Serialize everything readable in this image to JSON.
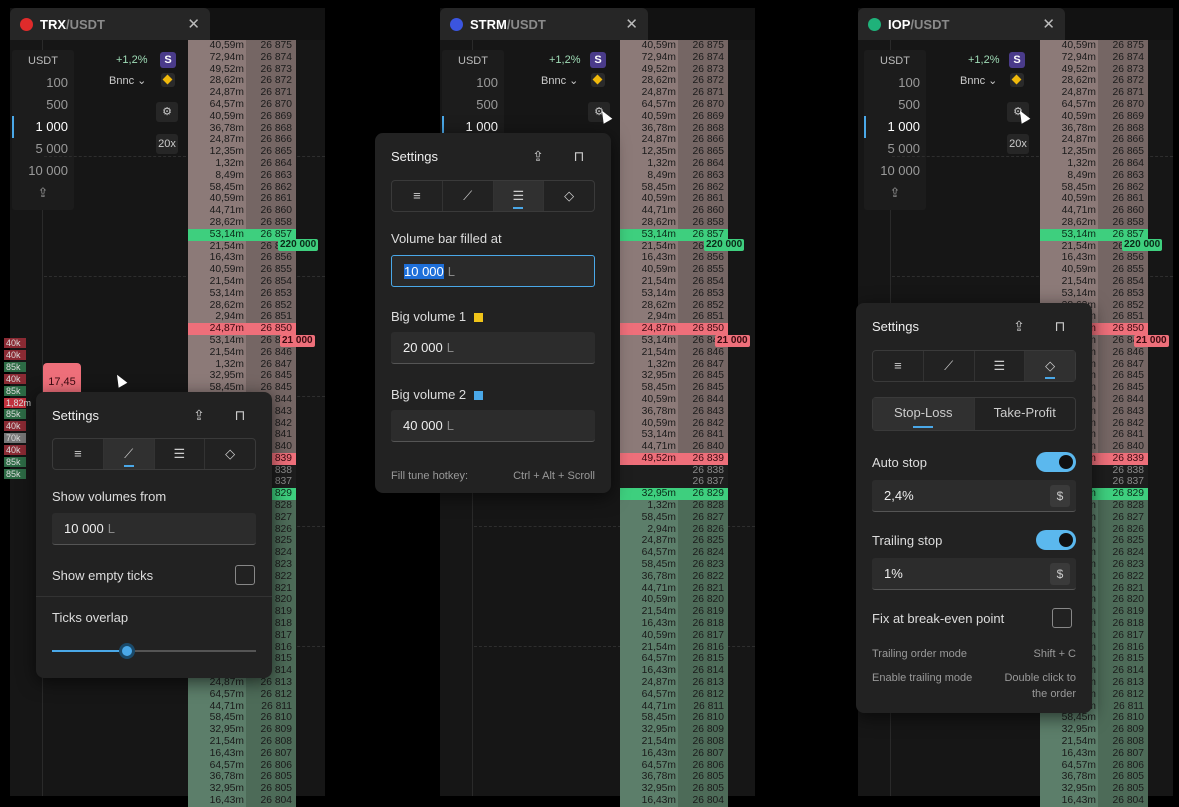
{
  "colors": {
    "accent": "#4aa8e8",
    "ask": "#8c7a78",
    "bid": "#5c7e6a",
    "green": "#3ecf7e",
    "red": "#ee6f7a",
    "yellow": "#f0c419",
    "blue": "#4aa8e8"
  },
  "panels": [
    {
      "tab": {
        "base": "TRX",
        "quote": "/USDT",
        "close": "✕",
        "icon_color": "#e02b2b"
      },
      "steps": {
        "head": "USDT",
        "values": [
          "100",
          "500",
          "1 000",
          "5 000",
          "10 000"
        ],
        "selected": "1 000"
      },
      "change": "+1,2%",
      "exchange": "Bnnc ⌄",
      "badge": "S",
      "leverage": "20x",
      "bigvol_green": "220 000",
      "bigvol_red": "21 000",
      "left_chip": "17,45"
    },
    {
      "tab": {
        "base": "STRM",
        "quote": "/USDT",
        "close": "✕",
        "icon_color": "#3b55e0"
      },
      "steps": {
        "head": "USDT",
        "values": [
          "100",
          "500",
          "1 000"
        ],
        "selected": "1 000"
      },
      "change": "+1,2%",
      "exchange": "Bnnc ⌄",
      "badge": "S",
      "bigvol_green": "220 000",
      "bigvol_red": "21 000"
    },
    {
      "tab": {
        "base": "IOP",
        "quote": "/USDT",
        "close": "✕",
        "icon_color": "#1fb27a"
      },
      "steps": {
        "head": "USDT",
        "values": [
          "100",
          "500",
          "1 000",
          "5 000",
          "10 000"
        ],
        "selected": "1 000"
      },
      "change": "+1,2%",
      "exchange": "Bnnc ⌄",
      "badge": "S",
      "leverage": "20x",
      "bigvol_green": "220 000",
      "bigvol_red": "21 000"
    }
  ],
  "orderbook": {
    "vols": [
      "40,59m",
      "72,94m",
      "49,52m",
      "28,62m",
      "24,87m",
      "64,57m",
      "40,59m",
      "36,78m",
      "24,87m",
      "12,35m",
      "1,32m",
      "8,49m",
      "58,45m",
      "40,59m",
      "44,71m",
      "28,62m",
      "53,14m",
      "21,54m",
      "16,43m",
      "40,59m",
      "21,54m",
      "53,14m",
      "28,62m",
      "2,94m",
      "24,87m",
      "53,14m",
      "21,54m",
      "1,32m",
      "32,95m",
      "58,45m",
      "40,59m",
      "36,78m",
      "40,59m",
      "53,14m",
      "44,71m",
      "49,52m",
      "",
      "",
      "32,95m",
      "1,32m",
      "58,45m",
      "2,94m",
      "24,87m",
      "64,57m",
      "58,45m",
      "36,78m",
      "44,71m",
      "40,59m",
      "21,54m",
      "16,43m",
      "40,59m",
      "21,54m",
      "64,57m",
      "16,43m",
      "24,87m",
      "64,57m",
      "44,71m",
      "58,45m",
      "32,95m",
      "21,54m",
      "16,43m",
      "64,57m",
      "36,78m",
      "32,95m",
      "16,43m"
    ],
    "prices": [
      "26 875",
      "26 874",
      "26 873",
      "26 872",
      "26 871",
      "26 870",
      "26 869",
      "26 868",
      "26 866",
      "26 865",
      "26 864",
      "26 863",
      "26 862",
      "26 861",
      "26 860",
      "26 858",
      "26 857",
      "26 857",
      "26 856",
      "26 855",
      "26 854",
      "26 853",
      "26 852",
      "26 851",
      "26 850",
      "26 848",
      "26 846",
      "26 847",
      "26 845",
      "26 845",
      "26 844",
      "26 843",
      "26 842",
      "26 841",
      "26 840",
      "26 839",
      "26 838",
      "26 837",
      "26 829",
      "26 828",
      "26 827",
      "26 826",
      "26 825",
      "26 824",
      "26 823",
      "26 822",
      "26 821",
      "26 820",
      "26 819",
      "26 818",
      "26 817",
      "26 816",
      "26 815",
      "26 814",
      "26 813",
      "26 812",
      "26 811",
      "26 810",
      "26 809",
      "26 808",
      "26 807",
      "26 806",
      "26 805",
      "26 805",
      "26 804"
    ]
  },
  "left_vols": [
    "40k",
    "40k",
    "85k",
    "40k",
    "85k",
    "1,82m",
    "85k",
    "40k",
    "70k",
    "40k",
    "85k",
    "85k"
  ],
  "settings_a": {
    "title": "Settings",
    "section_label": "Show volumes from",
    "field_value": "10 000",
    "field_unit": "L",
    "empty_ticks_label": "Show empty ticks",
    "overlap_label": "Ticks overlap",
    "slider_value": 0.37
  },
  "settings_b": {
    "title": "Settings",
    "filled_label": "Volume bar filled at",
    "filled_value": "10 000",
    "filled_unit": "L",
    "big1_label": "Big volume 1",
    "big1_value": "20 000",
    "big1_unit": "L",
    "big2_label": "Big volume 2",
    "big2_value": "40 000",
    "big2_unit": "L",
    "hotkey_label": "Fill tune hotkey:",
    "hotkey_value": "Ctrl + Alt + Scroll"
  },
  "settings_c": {
    "title": "Settings",
    "tab_sl": "Stop-Loss",
    "tab_tp": "Take-Profit",
    "auto_stop_label": "Auto stop",
    "auto_stop_value": "2,4%",
    "auto_stop_unit": "$",
    "trailing_label": "Trailing stop",
    "trailing_value": "1%",
    "trailing_unit": "$",
    "breakeven_label": "Fix at break-even point",
    "trailing_mode_label": "Trailing order mode",
    "trailing_mode_value": "Shift + C",
    "enable_trailing_label": "Enable trailing mode",
    "enable_trailing_value_1": "Double click to",
    "enable_trailing_value_2": "the order"
  }
}
